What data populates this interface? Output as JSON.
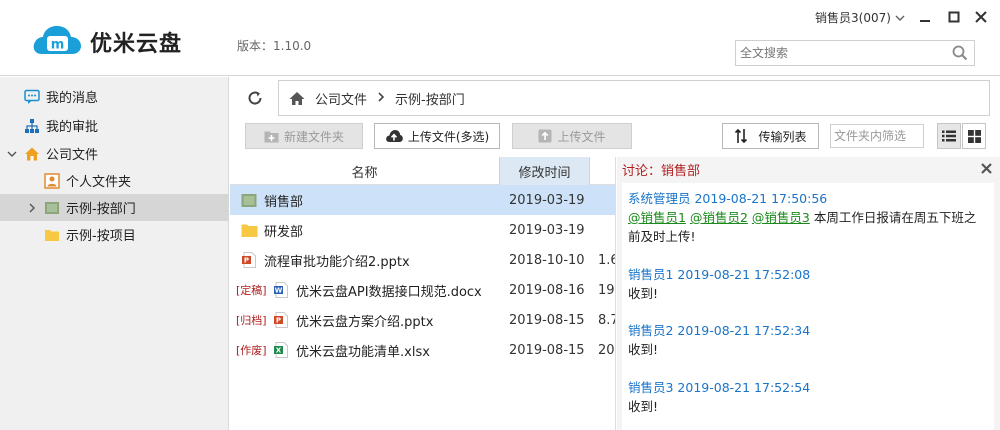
{
  "header": {
    "app_name": "优米云盘",
    "version": "版本：1.10.0",
    "user": "销售员3(007)",
    "search_placeholder": "全文搜索",
    "logo_color": "#1a9fd8"
  },
  "sidebar": {
    "items": [
      {
        "label": "我的消息",
        "icon": "message-icon"
      },
      {
        "label": "我的审批",
        "icon": "org-chart-icon"
      },
      {
        "label": "公司文件",
        "icon": "home-folder-icon"
      },
      {
        "label": "个人文件夹",
        "icon": "user-folder-icon"
      },
      {
        "label": "示例-按部门",
        "icon": "group-folder-icon"
      },
      {
        "label": "示例-按项目",
        "icon": "folder-icon"
      }
    ]
  },
  "toolbar": {
    "breadcrumb": [
      "公司文件",
      "示例-按部门"
    ],
    "new_folder": "新建文件夹",
    "upload_multi": "上传文件(多选)",
    "upload_file": "上传文件",
    "transfer_list": "传输列表",
    "filter_placeholder": "文件夹内筛选"
  },
  "filelist": {
    "headers": {
      "name": "名称",
      "modified": "修改时间"
    },
    "rows": [
      {
        "tag": "",
        "name": "销售部",
        "type": "group-folder",
        "date": "2019-03-19",
        "size": ""
      },
      {
        "tag": "",
        "name": "研发部",
        "type": "folder",
        "date": "2019-03-19",
        "size": ""
      },
      {
        "tag": "",
        "name": "流程审批功能介绍2.pptx",
        "type": "pptx",
        "date": "2018-10-10",
        "size": "1.6"
      },
      {
        "tag": "[定稿]",
        "name": "优米云盘API数据接口规范.docx",
        "type": "docx",
        "date": "2019-08-16",
        "size": "19"
      },
      {
        "tag": "[归档]",
        "name": "优米云盘方案介绍.pptx",
        "type": "pptx",
        "date": "2019-08-15",
        "size": "8.7"
      },
      {
        "tag": "[作废]",
        "name": "优米云盘功能清单.xlsx",
        "type": "xlsx",
        "date": "2019-08-15",
        "size": "20."
      }
    ]
  },
  "discussion": {
    "title": "讨论：销售部",
    "messages": [
      {
        "meta": "系统管理员 2019-08-21 17:50:56",
        "mentions": [
          "@销售员1",
          "@销售员2",
          "@销售员3"
        ],
        "text": "本周工作日报请在周五下班之前及时上传!"
      },
      {
        "meta": "销售员1 2019-08-21 17:52:08",
        "mentions": [],
        "text": "收到!"
      },
      {
        "meta": "销售员2 2019-08-21 17:52:34",
        "mentions": [],
        "text": "收到!"
      },
      {
        "meta": "销售员3 2019-08-21 17:52:54",
        "mentions": [],
        "text": "收到!"
      }
    ]
  }
}
